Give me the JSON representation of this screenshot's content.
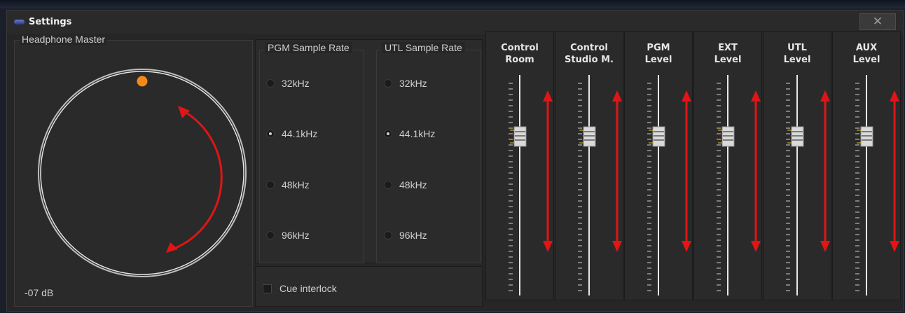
{
  "window": {
    "title": "Settings",
    "close_glyph": "✕"
  },
  "headphone": {
    "label": "Headphone Master",
    "value": "-07 dB"
  },
  "pgm_sample_rate": {
    "label": "PGM Sample Rate",
    "options": [
      "32kHz",
      "44.1kHz",
      "48kHz",
      "96kHz"
    ],
    "selected": "44.1kHz"
  },
  "utl_sample_rate": {
    "label": "UTL Sample Rate",
    "options": [
      "32kHz",
      "44.1kHz",
      "48kHz",
      "96kHz"
    ],
    "selected": "44.1kHz"
  },
  "cue_interlock": {
    "label": "Cue interlock",
    "checked": false
  },
  "faders": [
    {
      "line1": "Control",
      "line2": "Room"
    },
    {
      "line1": "Control",
      "line2": "Studio M."
    },
    {
      "line1": "PGM",
      "line2": "Level"
    },
    {
      "line1": "EXT",
      "line2": "Level"
    },
    {
      "line1": "UTL",
      "line2": "Level"
    },
    {
      "line1": "AUX",
      "line2": "Level"
    }
  ],
  "colors": {
    "arrow": "#e01515",
    "knob_indicator": "#f28a1a"
  },
  "icons": {
    "title": "window-app-icon",
    "close": "close-icon"
  }
}
